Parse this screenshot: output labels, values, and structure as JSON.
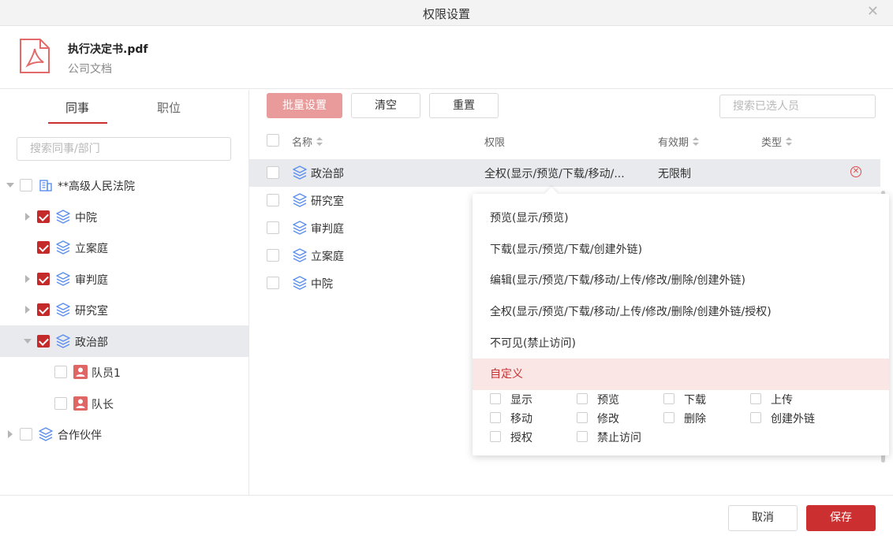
{
  "dialog": {
    "title": "权限设置"
  },
  "file": {
    "name": "执行决定书.pdf",
    "category": "公司文档",
    "icon": "pdf-file-icon"
  },
  "left": {
    "tabs": [
      "同事",
      "职位"
    ],
    "search_placeholder": "搜索同事/部门",
    "tree": [
      {
        "label": "**高级人民法院",
        "icon": "building-icon",
        "checked": false
      },
      {
        "label": "中院",
        "icon": "layers-icon",
        "checked": true
      },
      {
        "label": "立案庭",
        "icon": "layers-icon",
        "checked": true
      },
      {
        "label": "审判庭",
        "icon": "layers-icon",
        "checked": true
      },
      {
        "label": "研究室",
        "icon": "layers-icon",
        "checked": true
      },
      {
        "label": "政治部",
        "icon": "layers-icon",
        "checked": true
      },
      {
        "label": "队员1",
        "icon": "person-icon",
        "checked": false
      },
      {
        "label": "队长",
        "icon": "person-icon",
        "checked": false
      },
      {
        "label": "合作伙伴",
        "icon": "layers-icon",
        "checked": false
      }
    ]
  },
  "right": {
    "buttons": {
      "batch": "批量设置",
      "clear": "清空",
      "reset": "重置"
    },
    "search_placeholder": "搜索已选人员",
    "columns": {
      "name": "名称",
      "permission": "权限",
      "validity": "有效期",
      "type": "类型"
    },
    "rows": [
      {
        "name": "政治部",
        "permission": "全权(显示/预览/下载/移动/...",
        "validity": "无限制"
      },
      {
        "name": "研究室"
      },
      {
        "name": "审判庭"
      },
      {
        "name": "立案庭"
      },
      {
        "name": "中院"
      }
    ]
  },
  "popup": {
    "options": [
      "预览(显示/预览)",
      "下载(显示/预览/下载/创建外链)",
      "编辑(显示/预览/下载/移动/上传/修改/删除/创建外链)",
      "全权(显示/预览/下载/移动/上传/修改/删除/创建外链/授权)",
      "不可见(禁止访问)",
      "自定义"
    ],
    "custom": [
      "显示",
      "预览",
      "下载",
      "上传",
      "移动",
      "修改",
      "删除",
      "创建外链",
      "授权",
      "禁止访问"
    ]
  },
  "footer": {
    "cancel": "取消",
    "save": "保存"
  },
  "colors": {
    "accent": "#cc2f2f",
    "accent_light": "#e99a9a",
    "layers": "#5b8ef0",
    "person": "#e06666"
  }
}
